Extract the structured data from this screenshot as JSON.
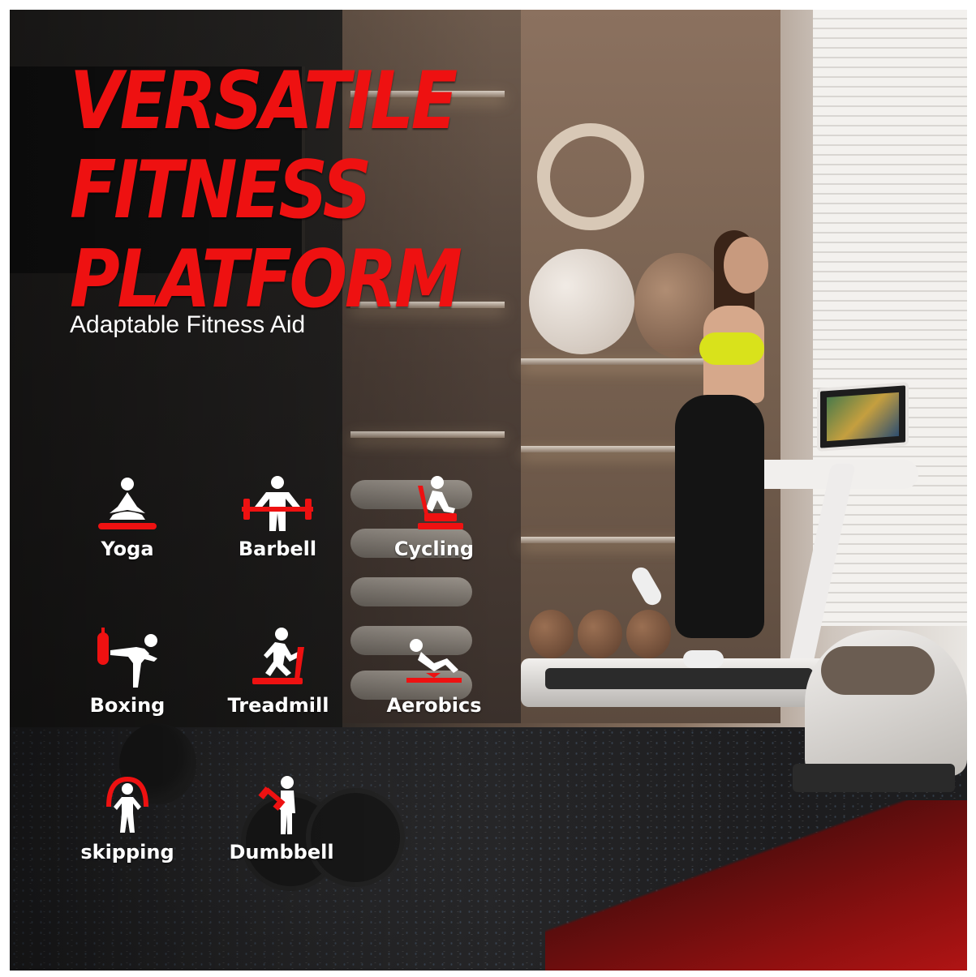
{
  "title_lines": [
    "VERSATILE",
    "FITNESS",
    "PLATFORM"
  ],
  "subtitle": "Adaptable Fitness Aid",
  "accent_color": "#ee1111",
  "activities": [
    {
      "label": "Yoga",
      "icon": "yoga-icon"
    },
    {
      "label": "Barbell",
      "icon": "barbell-icon"
    },
    {
      "label": "Cycling",
      "icon": "cycling-icon"
    },
    {
      "label": "Boxing",
      "icon": "boxing-icon"
    },
    {
      "label": "Treadmill",
      "icon": "treadmill-icon"
    },
    {
      "label": "Aerobics",
      "icon": "aerobics-icon"
    },
    {
      "label": "skipping",
      "icon": "skipping-icon"
    },
    {
      "label": "Dumbbell",
      "icon": "dumbbell-icon"
    }
  ]
}
